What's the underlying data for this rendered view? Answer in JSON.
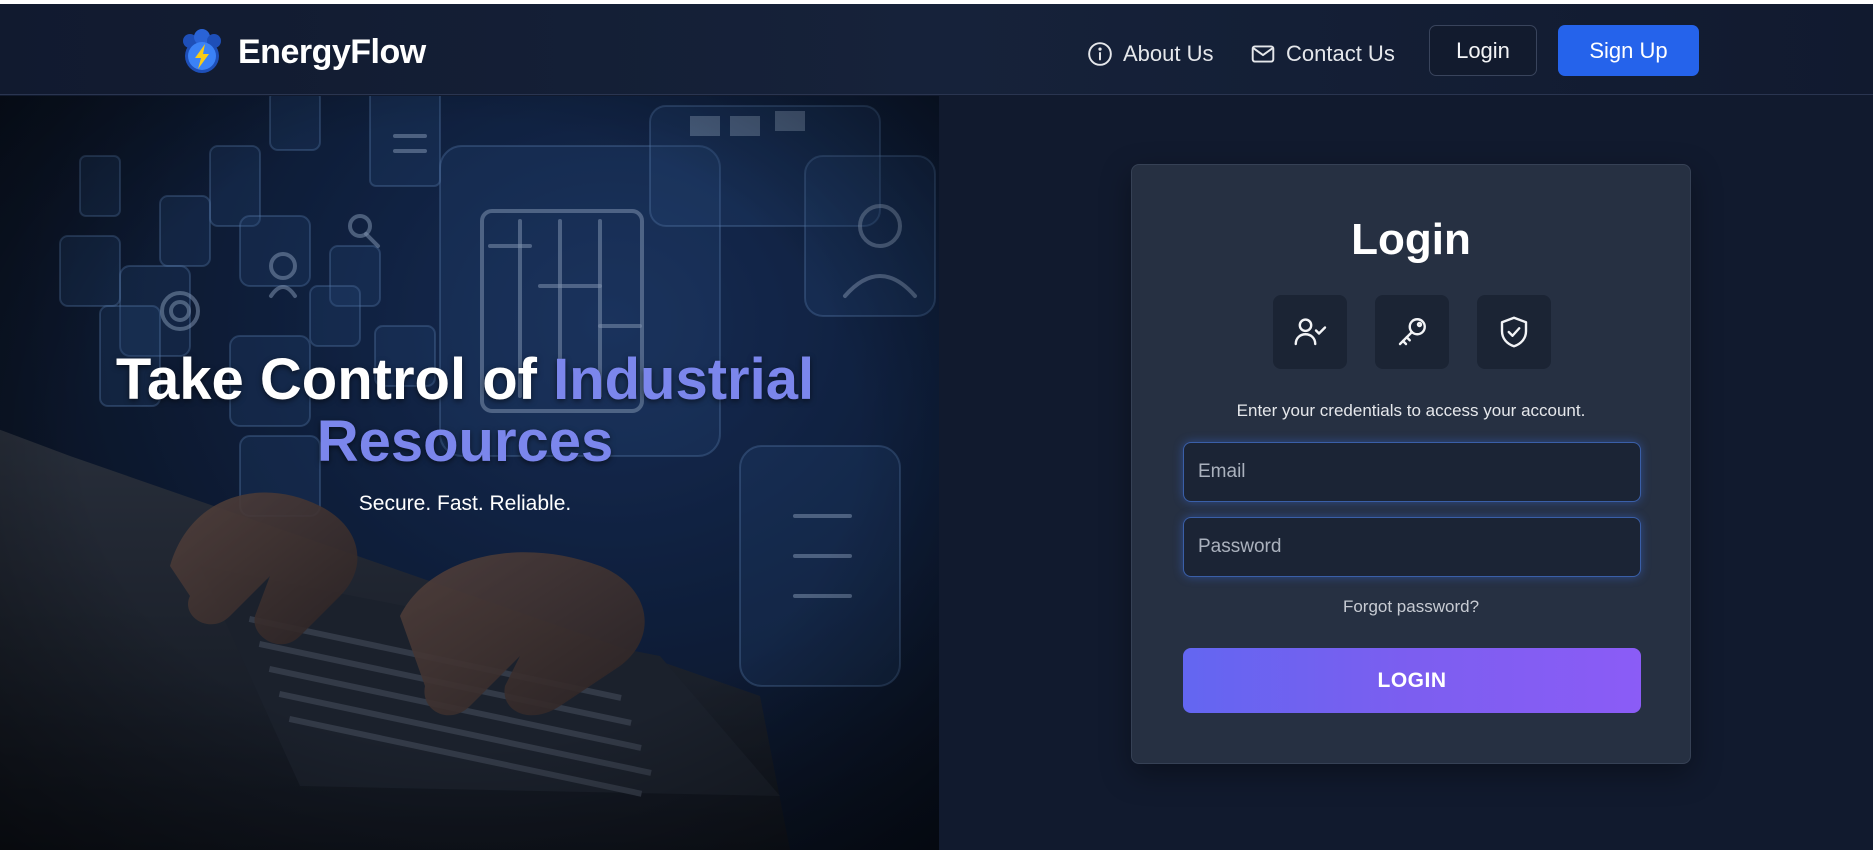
{
  "header": {
    "brand": "EnergyFlow",
    "nav": [
      {
        "label": "About Us",
        "icon": "info-icon"
      },
      {
        "label": "Contact Us",
        "icon": "mail-icon"
      }
    ],
    "login_label": "Login",
    "signup_label": "Sign Up"
  },
  "hero": {
    "title_main": "Take Control of ",
    "title_accent": "Industrial Resources",
    "subtitle": "Secure. Fast. Reliable."
  },
  "login_card": {
    "title": "Login",
    "icons": [
      "user-check-icon",
      "key-icon",
      "shield-check-icon"
    ],
    "description": "Enter your credentials to access your account.",
    "email_placeholder": "Email",
    "password_placeholder": "Password",
    "forgot_label": "Forgot password?",
    "submit_label": "LOGIN"
  },
  "colors": {
    "background": "#111a2e",
    "card": "#263042",
    "accent": "#7b86ec",
    "signup_button": "#2563eb",
    "login_gradient_start": "#6366f1",
    "login_gradient_end": "#8b5cf6"
  }
}
